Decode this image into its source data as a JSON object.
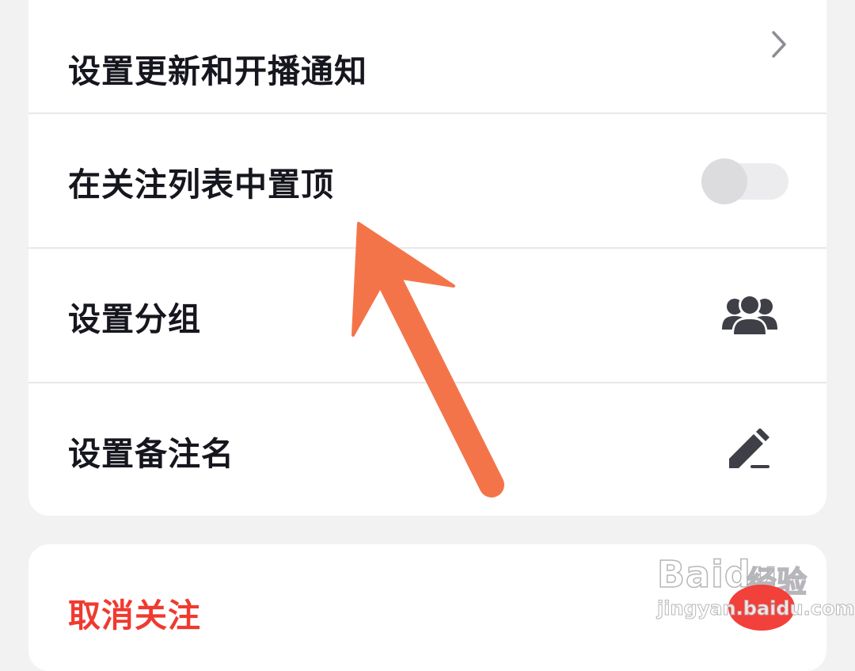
{
  "settings": {
    "update_notify": {
      "label": "设置更新和开播通知",
      "icon": "chevron-right-icon"
    },
    "pin_top": {
      "label": "在关注列表中置顶",
      "toggle_on": false
    },
    "set_group": {
      "label": "设置分组",
      "icon": "user-group-icon"
    },
    "set_remark": {
      "label": "设置备注名",
      "icon": "pencil-edit-icon"
    }
  },
  "unfollow": {
    "label": "取消关注"
  },
  "annotation": {
    "arrow_color": "#f4744a"
  },
  "watermark": {
    "brand": "Bai",
    "brand_suffix": "du",
    "brand_cn": "经验",
    "sub": "jingyan.baidu.com"
  },
  "colors": {
    "text": "#16161e",
    "danger": "#f03a2f",
    "icon": "#3e3f47",
    "toggle_off": "#ececee"
  }
}
